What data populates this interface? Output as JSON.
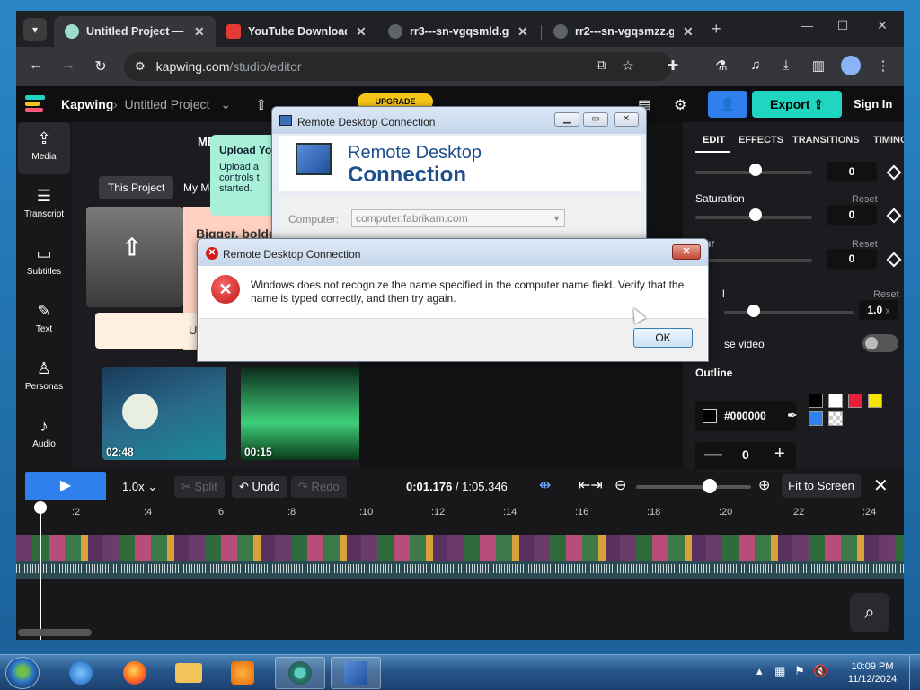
{
  "browser": {
    "tabs": [
      {
        "title": "Untitled Project — Kapwing",
        "active": true
      },
      {
        "title": "YouTube Downloader",
        "active": false
      },
      {
        "title": "rr3---sn-vgqsmld.googlevideo.com",
        "active": false
      },
      {
        "title": "rr2---sn-vgqsmzz.googlevideo.com",
        "active": false
      }
    ],
    "url_site": "kapwing.com",
    "url_path": "/studio/editor"
  },
  "kapwing": {
    "brand": "Kapwing",
    "project": "Untitled Project",
    "upgrade": "UPGRADE",
    "export": "Export",
    "signin": "Sign In",
    "sidebar": [
      {
        "label": "Media"
      },
      {
        "label": "Transcript"
      },
      {
        "label": "Subtitles"
      },
      {
        "label": "Text"
      },
      {
        "label": "Personas"
      },
      {
        "label": "Audio"
      }
    ],
    "media_panel_title": "MEDIA",
    "media_tabs": [
      "This Project",
      "My Media"
    ],
    "promo_title": "Bigger, bolder",
    "promo_button": "U",
    "tooltip_title": "Upload Yo",
    "tooltip_text": "Upload a controls t started.",
    "clips": [
      {
        "duration": "02:48"
      },
      {
        "duration": "00:15"
      }
    ],
    "right_tabs": [
      "EDIT",
      "EFFECTS",
      "TRANSITIONS",
      "TIMING"
    ],
    "top_value": "0",
    "saturation": {
      "label": "Saturation",
      "reset": "Reset",
      "value": "0"
    },
    "blur": {
      "label": "Blur",
      "reset": "Reset",
      "value": "0"
    },
    "speed": {
      "label": "l",
      "reset": "Reset",
      "value": "1.0",
      "unit": "x"
    },
    "reverse_label": "se video",
    "outline_label": "Outline",
    "outline_color": "#000000",
    "stepper_value": "0",
    "timeline": {
      "speed": "1.0x",
      "split": "Split",
      "undo": "Undo",
      "redo": "Redo",
      "current": "0:01.176",
      "total": "/ 1:05.346",
      "fit": "Fit to Screen",
      "ticks": [
        ":2",
        ":4",
        ":6",
        ":8",
        ":10",
        ":12",
        ":14",
        ":16",
        ":18",
        ":20",
        ":22",
        ":24"
      ]
    }
  },
  "rdc_main": {
    "title": "Remote Desktop Connection",
    "banner_line1": "Remote Desktop",
    "banner_line2": "Connection",
    "computer_label": "Computer:",
    "computer_value": "computer.fabrikam.com"
  },
  "error_dialog": {
    "title": "Remote Desktop Connection",
    "message": "Windows does not recognize the name specified in the computer name field. Verify that the name is typed correctly, and then try again.",
    "ok": "OK"
  },
  "taskbar": {
    "time": "10:09 PM",
    "date": "11/12/2024"
  },
  "colors": {
    "export_accent": "#1fd6c1",
    "invite_accent": "#2f80ed",
    "upgrade_accent": "#f5c518"
  }
}
